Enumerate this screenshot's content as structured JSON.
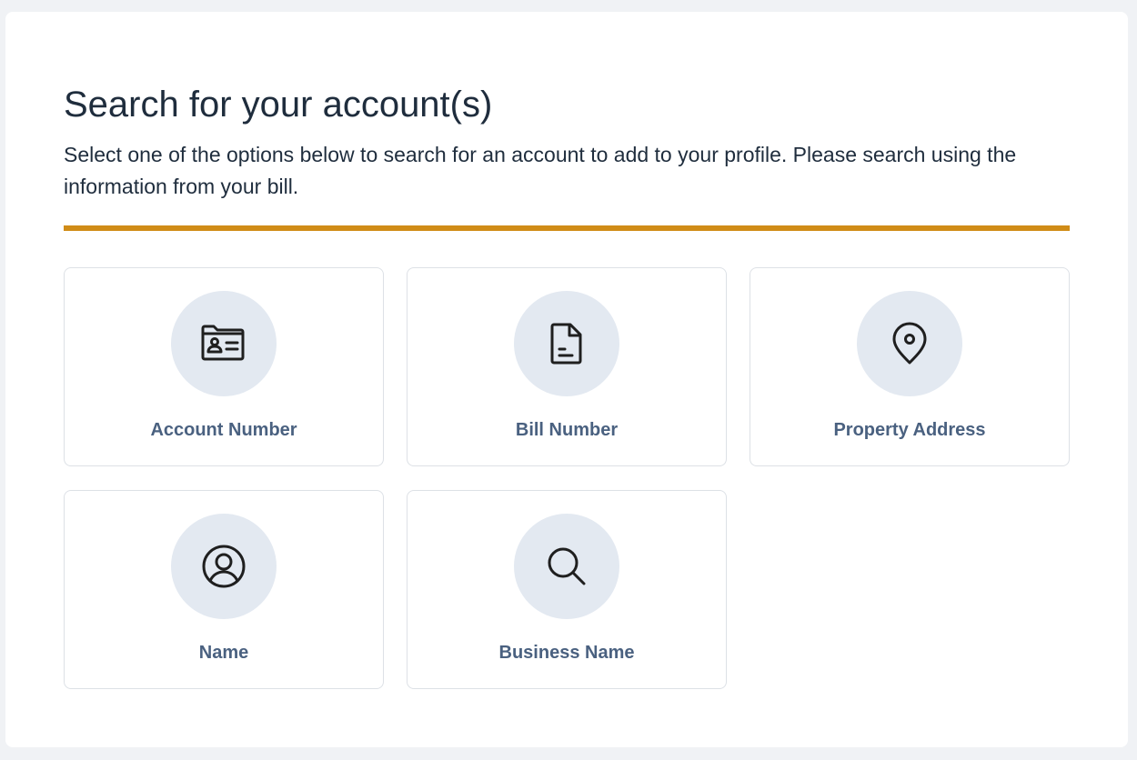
{
  "header": {
    "title": "Search for your account(s)",
    "description": "Select one of the options below to search for an account to add to your profile. Please search using the information from your bill."
  },
  "colors": {
    "accent": "#d08c17",
    "icon_circle": "#e3e9f1",
    "label": "#4a6180",
    "text": "#1f2d3d"
  },
  "options": [
    {
      "label": "Account Number",
      "icon": "account-folder-icon"
    },
    {
      "label": "Bill Number",
      "icon": "document-icon"
    },
    {
      "label": "Property Address",
      "icon": "map-pin-icon"
    },
    {
      "label": "Name",
      "icon": "user-circle-icon"
    },
    {
      "label": "Business Name",
      "icon": "search-icon"
    }
  ]
}
